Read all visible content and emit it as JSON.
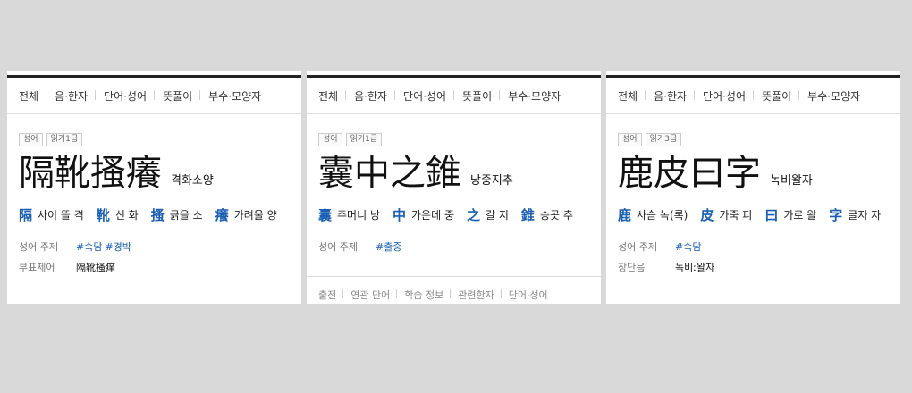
{
  "panels": [
    {
      "tabs": [
        "전체",
        "음·한자",
        "단어·성어",
        "뜻풀이",
        "부수·모양자"
      ],
      "badges": [
        "성어",
        "읽기1급"
      ],
      "hanja": "隔靴搔癢",
      "reading": "격화소양",
      "chars": [
        {
          "h": "隔",
          "m": "사이 뜰 격"
        },
        {
          "h": "靴",
          "m": "신 화"
        },
        {
          "h": "搔",
          "m": "긁을 소"
        },
        {
          "h": "癢",
          "m": "가려울 양"
        }
      ],
      "info1": {
        "k": "성어 주제",
        "tags": [
          "#속담",
          "#경박"
        ]
      },
      "info2": {
        "k": "부표제어",
        "v": "隔靴搔痒"
      }
    },
    {
      "tabs": [
        "전체",
        "음·한자",
        "단어·성어",
        "뜻풀이",
        "부수·모양자"
      ],
      "badges": [
        "성어",
        "읽기1급"
      ],
      "hanja": "囊中之錐",
      "reading": "낭중지추",
      "chars": [
        {
          "h": "囊",
          "m": "주머니 낭"
        },
        {
          "h": "中",
          "m": "가운데 중"
        },
        {
          "h": "之",
          "m": "갈 지"
        },
        {
          "h": "錐",
          "m": "송곳 추"
        }
      ],
      "info1": {
        "k": "성어 주제",
        "tags": [
          "#출중"
        ]
      },
      "subtabs": [
        "출전",
        "연관 단어",
        "학습 정보",
        "관련한자",
        "단어·성어"
      ]
    },
    {
      "tabs": [
        "전체",
        "음·한자",
        "단어·성어",
        "뜻풀이",
        "부수·모양자"
      ],
      "badges": [
        "성어",
        "읽기3급"
      ],
      "hanja": "鹿皮曰字",
      "reading": "녹비왈자",
      "chars": [
        {
          "h": "鹿",
          "m": "사슴 녹(록)"
        },
        {
          "h": "皮",
          "m": "가죽 피"
        },
        {
          "h": "曰",
          "m": "가로 왈"
        },
        {
          "h": "字",
          "m": "글자 자"
        }
      ],
      "info1": {
        "k": "성어 주제",
        "tags": [
          "#속담"
        ]
      },
      "info2": {
        "k": "장단음",
        "v": "녹비ː왈자"
      }
    }
  ]
}
